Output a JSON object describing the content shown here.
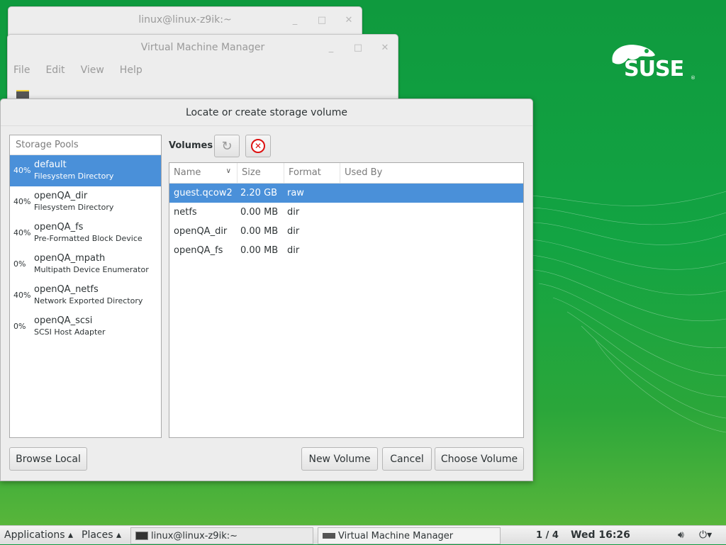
{
  "desktop": {
    "brand": "SUSE",
    "registered": "®"
  },
  "terminal_window": {
    "title": "linux@linux-z9ik:~"
  },
  "vmm_window": {
    "title": "Virtual Machine Manager",
    "menu": [
      "File",
      "Edit",
      "View",
      "Help"
    ]
  },
  "wm": {
    "minimize": "_",
    "maximize": "□",
    "close": "✕"
  },
  "dialog": {
    "title": "Locate or create storage volume",
    "pools_header": "Storage Pools",
    "pools": [
      {
        "pct": "40%",
        "name": "default",
        "type": "Filesystem Directory",
        "selected": true
      },
      {
        "pct": "40%",
        "name": "openQA_dir",
        "type": "Filesystem Directory",
        "selected": false
      },
      {
        "pct": "40%",
        "name": "openQA_fs",
        "type": "Pre-Formatted Block Device",
        "selected": false
      },
      {
        "pct": "0%",
        "name": "openQA_mpath",
        "type": "Multipath Device Enumerator",
        "selected": false
      },
      {
        "pct": "40%",
        "name": "openQA_netfs",
        "type": "Network Exported Directory",
        "selected": false
      },
      {
        "pct": "0%",
        "name": "openQA_scsi",
        "type": "SCSI Host Adapter",
        "selected": false
      }
    ],
    "volumes_label": "Volumes",
    "columns": {
      "name": "Name",
      "size": "Size",
      "format": "Format",
      "used_by": "Used By"
    },
    "volumes": [
      {
        "name": "guest.qcow2",
        "size": "2.20 GB",
        "format": "raw",
        "used_by": "",
        "selected": true
      },
      {
        "name": "netfs",
        "size": "0.00 MB",
        "format": "dir",
        "used_by": "",
        "selected": false
      },
      {
        "name": "openQA_dir",
        "size": "0.00 MB",
        "format": "dir",
        "used_by": "",
        "selected": false
      },
      {
        "name": "openQA_fs",
        "size": "0.00 MB",
        "format": "dir",
        "used_by": "",
        "selected": false
      }
    ],
    "buttons": {
      "browse_local": "Browse Local",
      "new_volume": "New Volume",
      "cancel": "Cancel",
      "choose_volume": "Choose Volume"
    }
  },
  "taskbar": {
    "applications": "Applications ▴",
    "places": "Places ▴",
    "tasks": [
      "linux@linux-z9ik:~",
      "Virtual Machine Manager"
    ],
    "workspace": "1 / 4",
    "clock": "Wed 16:26"
  }
}
